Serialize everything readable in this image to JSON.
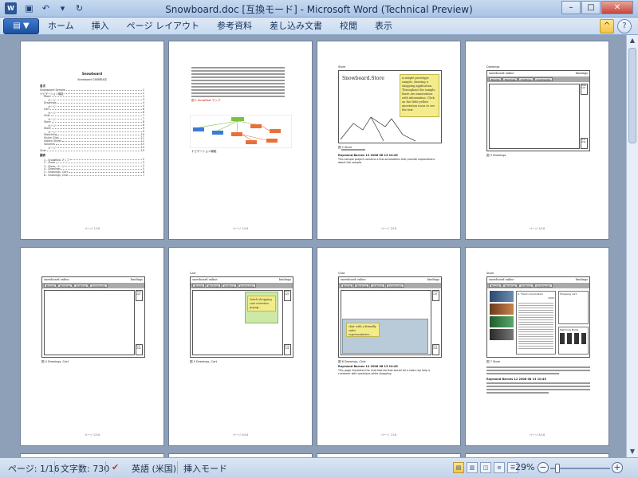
{
  "window": {
    "title": "Snowboard.doc [互換モード] - Microsoft Word (Technical Preview)",
    "app_icon": "W"
  },
  "qat": {
    "save_icon": "save-icon",
    "undo_icon": "undo-icon",
    "redo_icon": "redo-icon"
  },
  "ribbon": {
    "file_label": "▼",
    "tabs": [
      "ホーム",
      "挿入",
      "ページ レイアウト",
      "参考資料",
      "差し込み文書",
      "校閲",
      "表示"
    ]
  },
  "pages": {
    "p1": {
      "title": "Snowboard",
      "subtitle": "Snowboard 2008年4月",
      "section_contents": "目次",
      "section_figures": "図表",
      "toc": [
        "Snowboard Sample",
        "ナビゲーション機能",
        "Store",
        "ページ",
        "Drawings",
        "ページ",
        "Cart",
        "ページ",
        "Chat",
        "ページ",
        "Store",
        "ページ",
        "Store",
        "ページ",
        "Sketching",
        "Vision Clips",
        "Sketch Styles",
        "Volumes",
        "ページ",
        "Chat"
      ],
      "figures": [
        "1 - Snowflow マップ",
        "2 - Store",
        "3 - Store, ページ",
        "4 - Drawings",
        "5 - Drawings, Cart",
        "6 - Drawings, Chat"
      ],
      "footer": "ページ 1/16"
    },
    "p2": {
      "fig_caption": "図 1 Snowflow マップ",
      "section": "ナビゲーション機能",
      "footer": "ページ 2/16"
    },
    "p3": {
      "heading": "Store",
      "store_title": "Snowboard.Store",
      "note_text": "A simple prototype sample, showing a shopping application. Throughout the sample, there are annotations with information. Click on the little yellow annotation icons to see the text.",
      "fig_caption": "図 2 Store",
      "author_line": "Raymond Barnes 12 2008 08 13 10:45",
      "body_text": "This sample project contains a few annotations that provide explanations about the sample.",
      "footer": "ページ 3/16"
    },
    "p4": {
      "heading": "Drawings",
      "brand": "snowboard online",
      "bindings": "bindings",
      "nav": [
        "Boards",
        "Bindings",
        "Clothing",
        "Community"
      ],
      "side_top": "View cart",
      "side_bottom": "Live chat",
      "fig_caption": "図 3 Drawings",
      "footer": "ページ 4/16"
    },
    "p5": {
      "fig_caption": "図 4 Drawings, Cart",
      "footer": "ページ 5/16"
    },
    "p6": {
      "heading": "Cart",
      "note_text": "Quick shopping cart overview popup...",
      "fig_caption": "図 5 Drawings, Cart",
      "footer": "ページ 6/16"
    },
    "p7": {
      "heading": "Chat",
      "note_text": "chat with a friendly sales representative...",
      "fig_caption": "図 6 Drawings, Chat",
      "author_line": "Raymond Barnes 12 2008 08 13 10:45",
      "body_text": "This page illustrates the chat feature that would let a sales rep help a customer with questions while shopping.",
      "footer": "ページ 7/16"
    },
    "p8": {
      "heading": "Store",
      "product_title": "A. Tiwlon Corporation",
      "price": "$100",
      "shopping_cart": "Shopping cart",
      "matching": "Matching Boots",
      "fig_caption": "図 7 Store",
      "author_line": "Raymond Barnes 12 2008 08 13 10:45",
      "footer": "ページ 8/16"
    }
  },
  "status": {
    "page": "ページ: 1/16",
    "word_count": "文字数: 730",
    "language": "英語 (米国)",
    "insert_mode": "挿入モード",
    "zoom": "29%",
    "zoom_level": 0.29
  }
}
